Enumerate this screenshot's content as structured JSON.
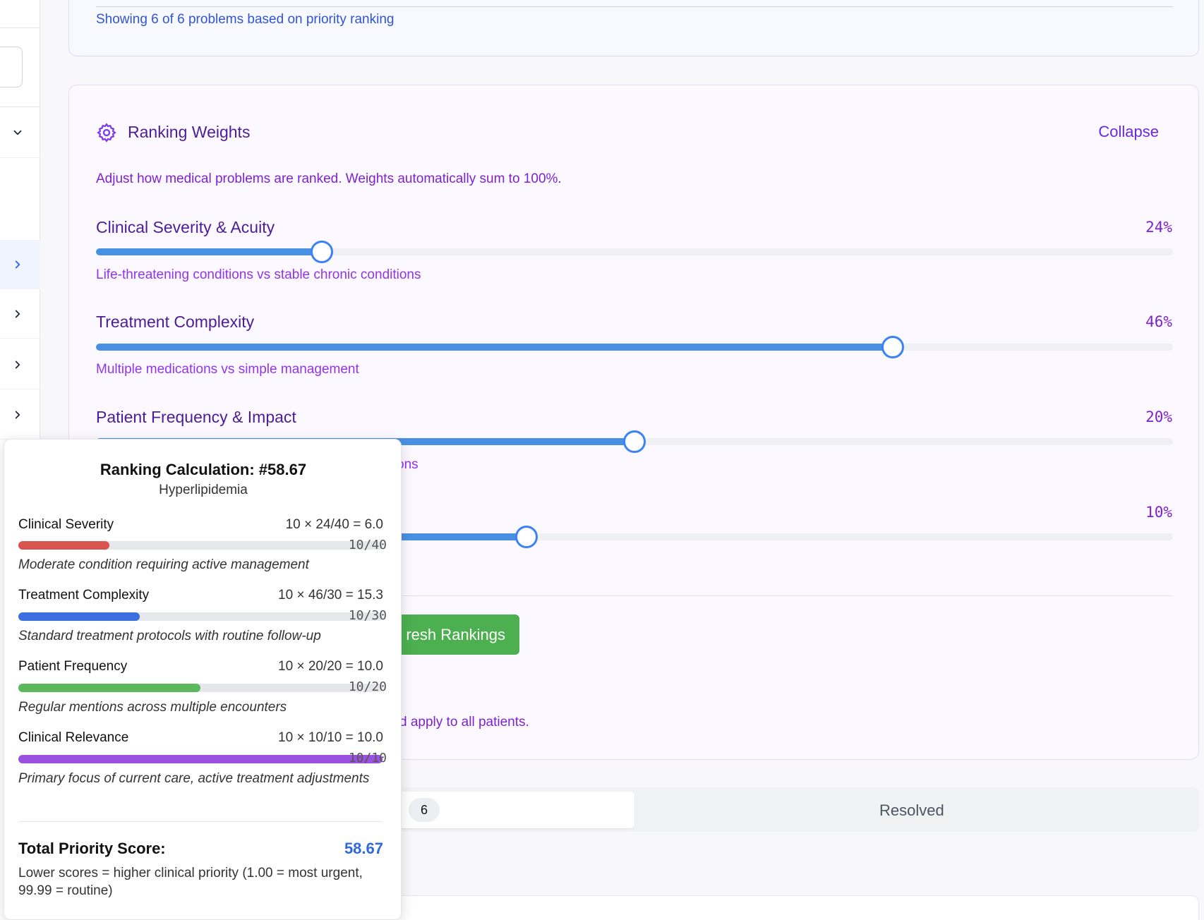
{
  "header": {
    "showing_text": "Showing 6 of 6 problems based on priority ranking"
  },
  "weights": {
    "title": "Ranking Weights",
    "collapse_label": "Collapse",
    "description": "Adjust how medical problems are ranked. Weights automatically sum to 100%.",
    "items": [
      {
        "label": "Clinical Severity & Acuity",
        "percent_text": "24%",
        "slider_value": 0.21,
        "hint": "Life-threatening conditions vs stable chronic conditions"
      },
      {
        "label": "Treatment Complexity",
        "percent_text": "46%",
        "slider_value": 0.74,
        "hint": "Multiple medications vs simple management"
      },
      {
        "label": "Patient Frequency & Impact",
        "percent_text": "20%",
        "slider_value": 0.5,
        "hint": "ons"
      },
      {
        "label": "",
        "percent_text": "10%",
        "slider_value": 0.4,
        "hint": ""
      }
    ],
    "refresh_label": "resh Rankings",
    "note_text": "d apply to all patients."
  },
  "tabs": {
    "active_count": "6",
    "resolved_label": "Resolved"
  },
  "tooltip": {
    "title": "Ranking Calculation: #58.67",
    "subtitle": "Hyperlipidemia",
    "rows": [
      {
        "name": "Clinical Severity",
        "formula": "10 × 24/40 = 6.0",
        "score_text": "10/40",
        "fill": 0.25,
        "color": "#d9534f",
        "description": "Moderate condition requiring active management"
      },
      {
        "name": "Treatment Complexity",
        "formula": "10 × 46/30 = 15.3",
        "score_text": "10/30",
        "fill": 0.333,
        "color": "#3b6fe0",
        "description": "Standard treatment protocols with routine follow-up"
      },
      {
        "name": "Patient Frequency",
        "formula": "10 × 20/20 = 10.0",
        "score_text": "10/20",
        "fill": 0.5,
        "color": "#5cb85c",
        "description": "Regular mentions across multiple encounters"
      },
      {
        "name": "Clinical Relevance",
        "formula": "10 × 10/10 = 10.0",
        "score_text": "10/10",
        "fill": 1.0,
        "color": "#9b51e0",
        "description": "Primary focus of current care, active treatment adjustments"
      }
    ],
    "total_label": "Total Priority Score:",
    "total_value": "58.67",
    "note": "Lower scores = higher clinical priority (1.00 = most urgent, 99.99 = routine)"
  }
}
